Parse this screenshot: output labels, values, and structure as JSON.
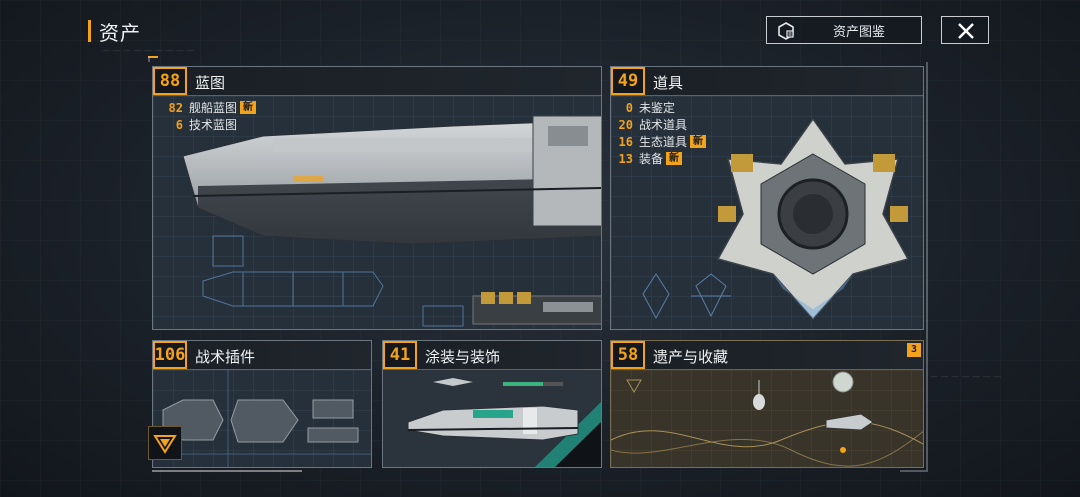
{
  "header": {
    "title": "资产",
    "codex_button_label": "资产图鉴",
    "codex_icon": "archive-box-icon",
    "close_icon": "close-icon"
  },
  "cards": {
    "blueprints": {
      "count": "88",
      "title": "蓝图",
      "items": [
        {
          "count": "82",
          "label": "舰船蓝图",
          "badge": "新"
        },
        {
          "count": "6",
          "label": "技术蓝图"
        }
      ]
    },
    "items": {
      "count": "49",
      "title": "道具",
      "items": [
        {
          "count": "0",
          "label": "未鉴定"
        },
        {
          "count": "20",
          "label": "战术道具"
        },
        {
          "count": "16",
          "label": "生态道具",
          "badge": "新"
        },
        {
          "count": "13",
          "label": "装备",
          "badge": "新"
        }
      ]
    },
    "plugins": {
      "count": "106",
      "title": "战术插件"
    },
    "paint": {
      "count": "41",
      "title": "涂装与装饰"
    },
    "legacy": {
      "count": "58",
      "title": "遗产与收藏",
      "badge": "3"
    }
  },
  "colors": {
    "accent": "#f3a21b",
    "card_bg": "#26303b",
    "legacy_bg": "#3a3526",
    "paint_teal": "#1e8f7e"
  }
}
